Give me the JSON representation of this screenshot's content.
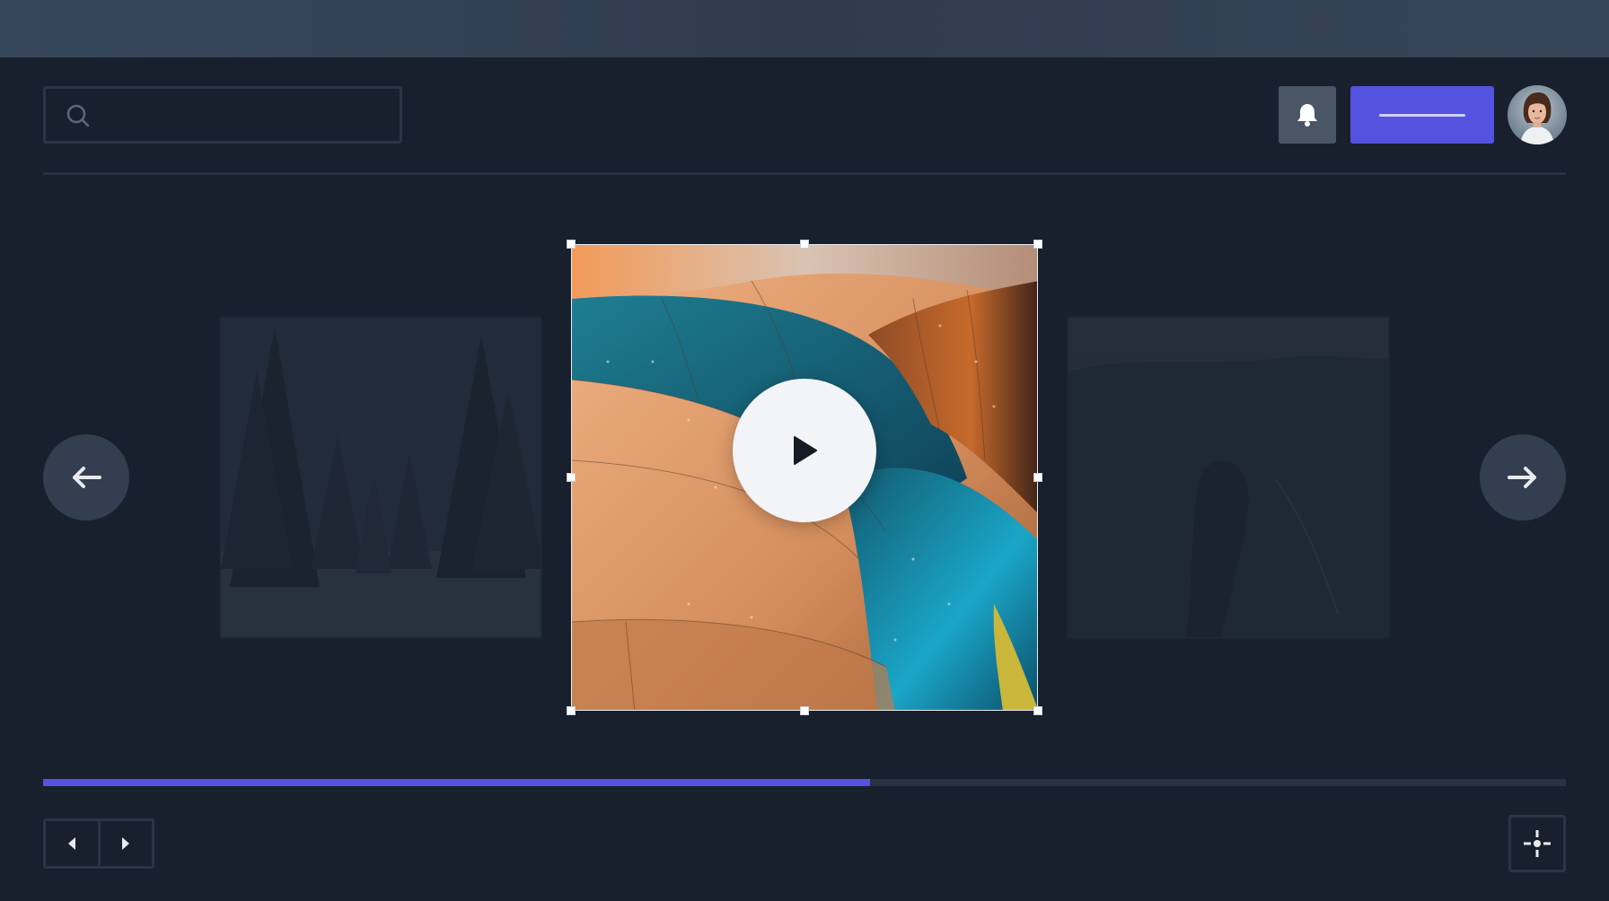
{
  "search": {
    "placeholder": ""
  },
  "header": {
    "notifications_icon": "bell-icon",
    "primary_button_label": "",
    "avatar_alt": "user avatar"
  },
  "carousel": {
    "prev_icon": "arrow-left-icon",
    "next_icon": "arrow-right-icon",
    "play_icon": "play-icon",
    "slides": [
      "snowy-forest-thumbnail",
      "abstract-metal-architecture",
      "dark-landscape-thumbnail"
    ]
  },
  "progress": {
    "fraction": 0.543
  },
  "footer": {
    "pager_prev_icon": "caret-left-icon",
    "pager_next_icon": "caret-right-icon",
    "target_icon": "crosshair-icon"
  },
  "colors": {
    "background": "#19202d",
    "accent": "#5452df",
    "topbar": "#37475b"
  }
}
